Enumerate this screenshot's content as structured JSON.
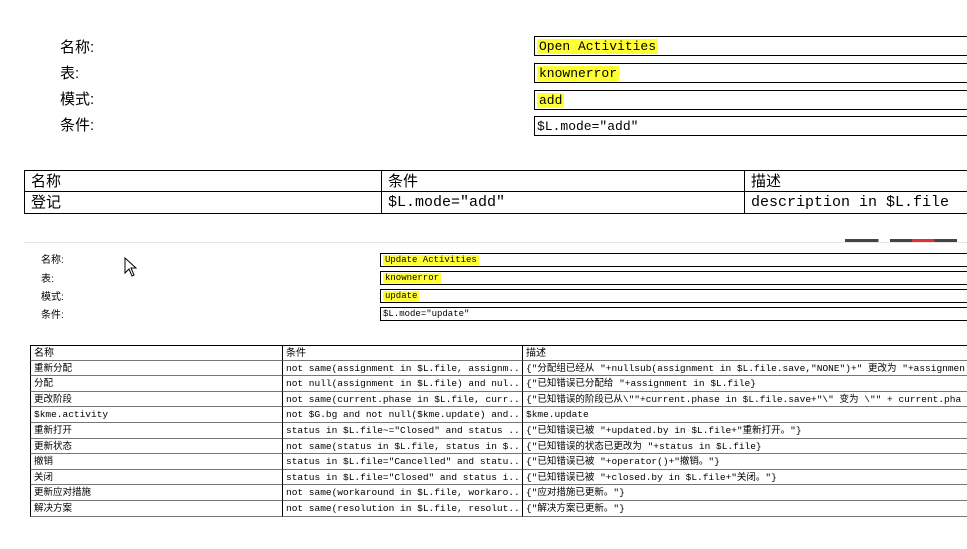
{
  "form1": {
    "labels": [
      "名称:",
      "表:",
      "模式:",
      "条件:"
    ],
    "values": [
      "Open Activities",
      "knownerror",
      "add",
      "$L.mode=\"add\""
    ]
  },
  "table1": {
    "headers": [
      "名称",
      "条件",
      "描述"
    ],
    "rows": [
      [
        "登记",
        "$L.mode=\"add\"",
        "description in $L.file"
      ]
    ]
  },
  "form2": {
    "labels": [
      "名称:",
      "表:",
      "模式:",
      "条件:"
    ],
    "values": [
      "Update Activities",
      "knownerror",
      "update",
      "$L.mode=\"update\""
    ]
  },
  "table2": {
    "headers": [
      "名称",
      "条件",
      "描述"
    ],
    "rows": [
      [
        "重新分配",
        "not same(assignment in $L.file, assignm...",
        "{\"分配组已经从 \"+nullsub(assignment in $L.file.save,\"NONE\")+\" 更改为 \"+assignmen"
      ],
      [
        "分配",
        "not null(assignment in $L.file) and nul...",
        "{\"已知错误已分配给 \"+assignment in $L.file}"
      ],
      [
        "更改阶段",
        "not same(current.phase in $L.file, curr...",
        "{\"已知错误的阶段已从\\\"\"+current.phase in $L.file.save+\"\\\" 变为 \\\"\" + current.pha"
      ],
      [
        "$kme.activity",
        "not $G.bg and not null($kme.update) and...",
        "$kme.update"
      ],
      [
        "重新打开",
        "status in $L.file~=\"Closed\" and status ...",
        "{\"已知错误已被 \"+updated.by in $L.file+\"重新打开。\"}"
      ],
      [
        "更新状态",
        "not same(status in $L.file, status in $...",
        "{\"已知错误的状态已更改为 \"+status in $L.file}"
      ],
      [
        "撤销",
        "status in $L.file=\"Cancelled\" and statu...",
        "{\"已知错误已被 \"+operator()+\"撤销。\"}"
      ],
      [
        "关闭",
        "status in $L.file=\"Closed\" and status i...",
        "{\"已知错误已被 \"+closed.by in $L.file+\"关闭。\"}"
      ],
      [
        "更新应对措施",
        "not same(workaround in $L.file, workaro...",
        "{\"应对措施已更新。\"}"
      ],
      [
        "解决方案",
        "not same(resolution in $L.file, resolut...",
        "{\"解决方案已更新。\"}"
      ]
    ]
  },
  "icons": {
    "cursor": "mouse-pointer-icon"
  },
  "colors": {
    "highlight": "#ffff33"
  }
}
